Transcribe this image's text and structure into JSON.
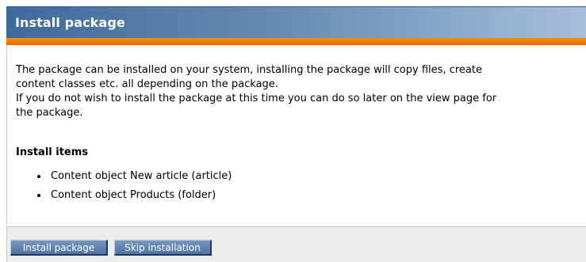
{
  "panel": {
    "title": "Install package"
  },
  "description": {
    "line1": "The package can be installed on your system, installing the package will copy files, create",
    "line2": "content classes etc. all depending on the package.",
    "line3": "If you do not wish to install the package at this time you can do so later on the view page for",
    "line4": "the package."
  },
  "install_items": {
    "heading": "Install items",
    "items": [
      "Content object New article (article)",
      "Content object Products (folder)"
    ]
  },
  "buttons": {
    "install_label": "Install package",
    "skip_label": "Skip installation"
  },
  "colors": {
    "header": "#4f76a6",
    "accent_bar": "#e8780a",
    "button": "#5a7dab"
  }
}
